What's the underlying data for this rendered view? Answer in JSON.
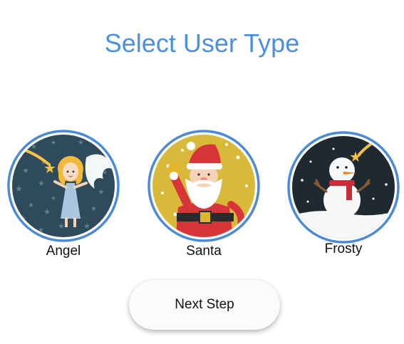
{
  "page": {
    "title": "Select User Type"
  },
  "user_types": [
    {
      "label": "Angel",
      "icon": "angel-icon"
    },
    {
      "label": "Santa",
      "icon": "santa-icon"
    },
    {
      "label": "Frosty",
      "icon": "snowman-icon"
    }
  ],
  "actions": {
    "next_label": "Next Step"
  },
  "colors": {
    "accent": "#4a90e2",
    "ring": "#4a8ad6",
    "angel_bg": "#2f4a5a",
    "santa_bg": "#d8b93a",
    "frosty_bg": "#1e2a30"
  }
}
